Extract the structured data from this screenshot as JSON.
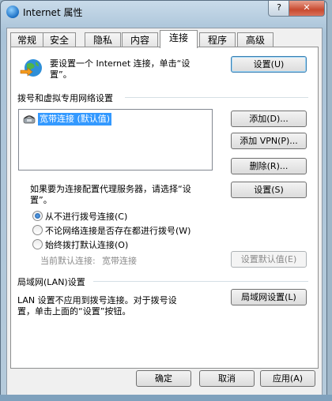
{
  "window": {
    "title": "Internet 属性",
    "help": "?",
    "close": "✕"
  },
  "tabs": [
    "常规",
    "安全",
    "隐私",
    "内容",
    "连接",
    "程序",
    "高级"
  ],
  "active_tab": "连接",
  "setup": {
    "text_line1": "要设置一个 Internet 连接，单击“设",
    "text_line2": "置”。",
    "button": "设置(U)"
  },
  "dialup": {
    "group_title": "拨号和虚拟专用网络设置",
    "connections": [
      {
        "name": "宽带连接 (默认值)",
        "selected": true
      }
    ],
    "add": "添加(D)...",
    "add_vpn": "添加 VPN(P)...",
    "remove": "删除(R)...",
    "proxy_line1": "如果要为连接配置代理服务器，请选择“设",
    "proxy_line2": "置”。",
    "settings": "设置(S)",
    "options": [
      {
        "label": "从不进行拨号连接(C)",
        "checked": true
      },
      {
        "label": "不论网络连接是否存在都进行拨号(W)",
        "checked": false
      },
      {
        "label": "始终拨打默认连接(O)",
        "checked": false
      }
    ],
    "current_default_label": "当前默认连接:",
    "current_default_value": "宽带连接",
    "set_default": "设置默认值(E)"
  },
  "lan": {
    "group_title": "局域网(LAN)设置",
    "text_line1": "LAN 设置不应用到拨号连接。对于拨号设",
    "text_line2": "置，单击上面的“设置”按钮。",
    "button": "局域网设置(L)"
  },
  "footer": {
    "ok": "确定",
    "cancel": "取消",
    "apply": "应用(A)"
  },
  "colors": {
    "selection": "#3399ff",
    "focus_border": "#3c7fb1",
    "disabled_text": "#8a8a8a"
  }
}
